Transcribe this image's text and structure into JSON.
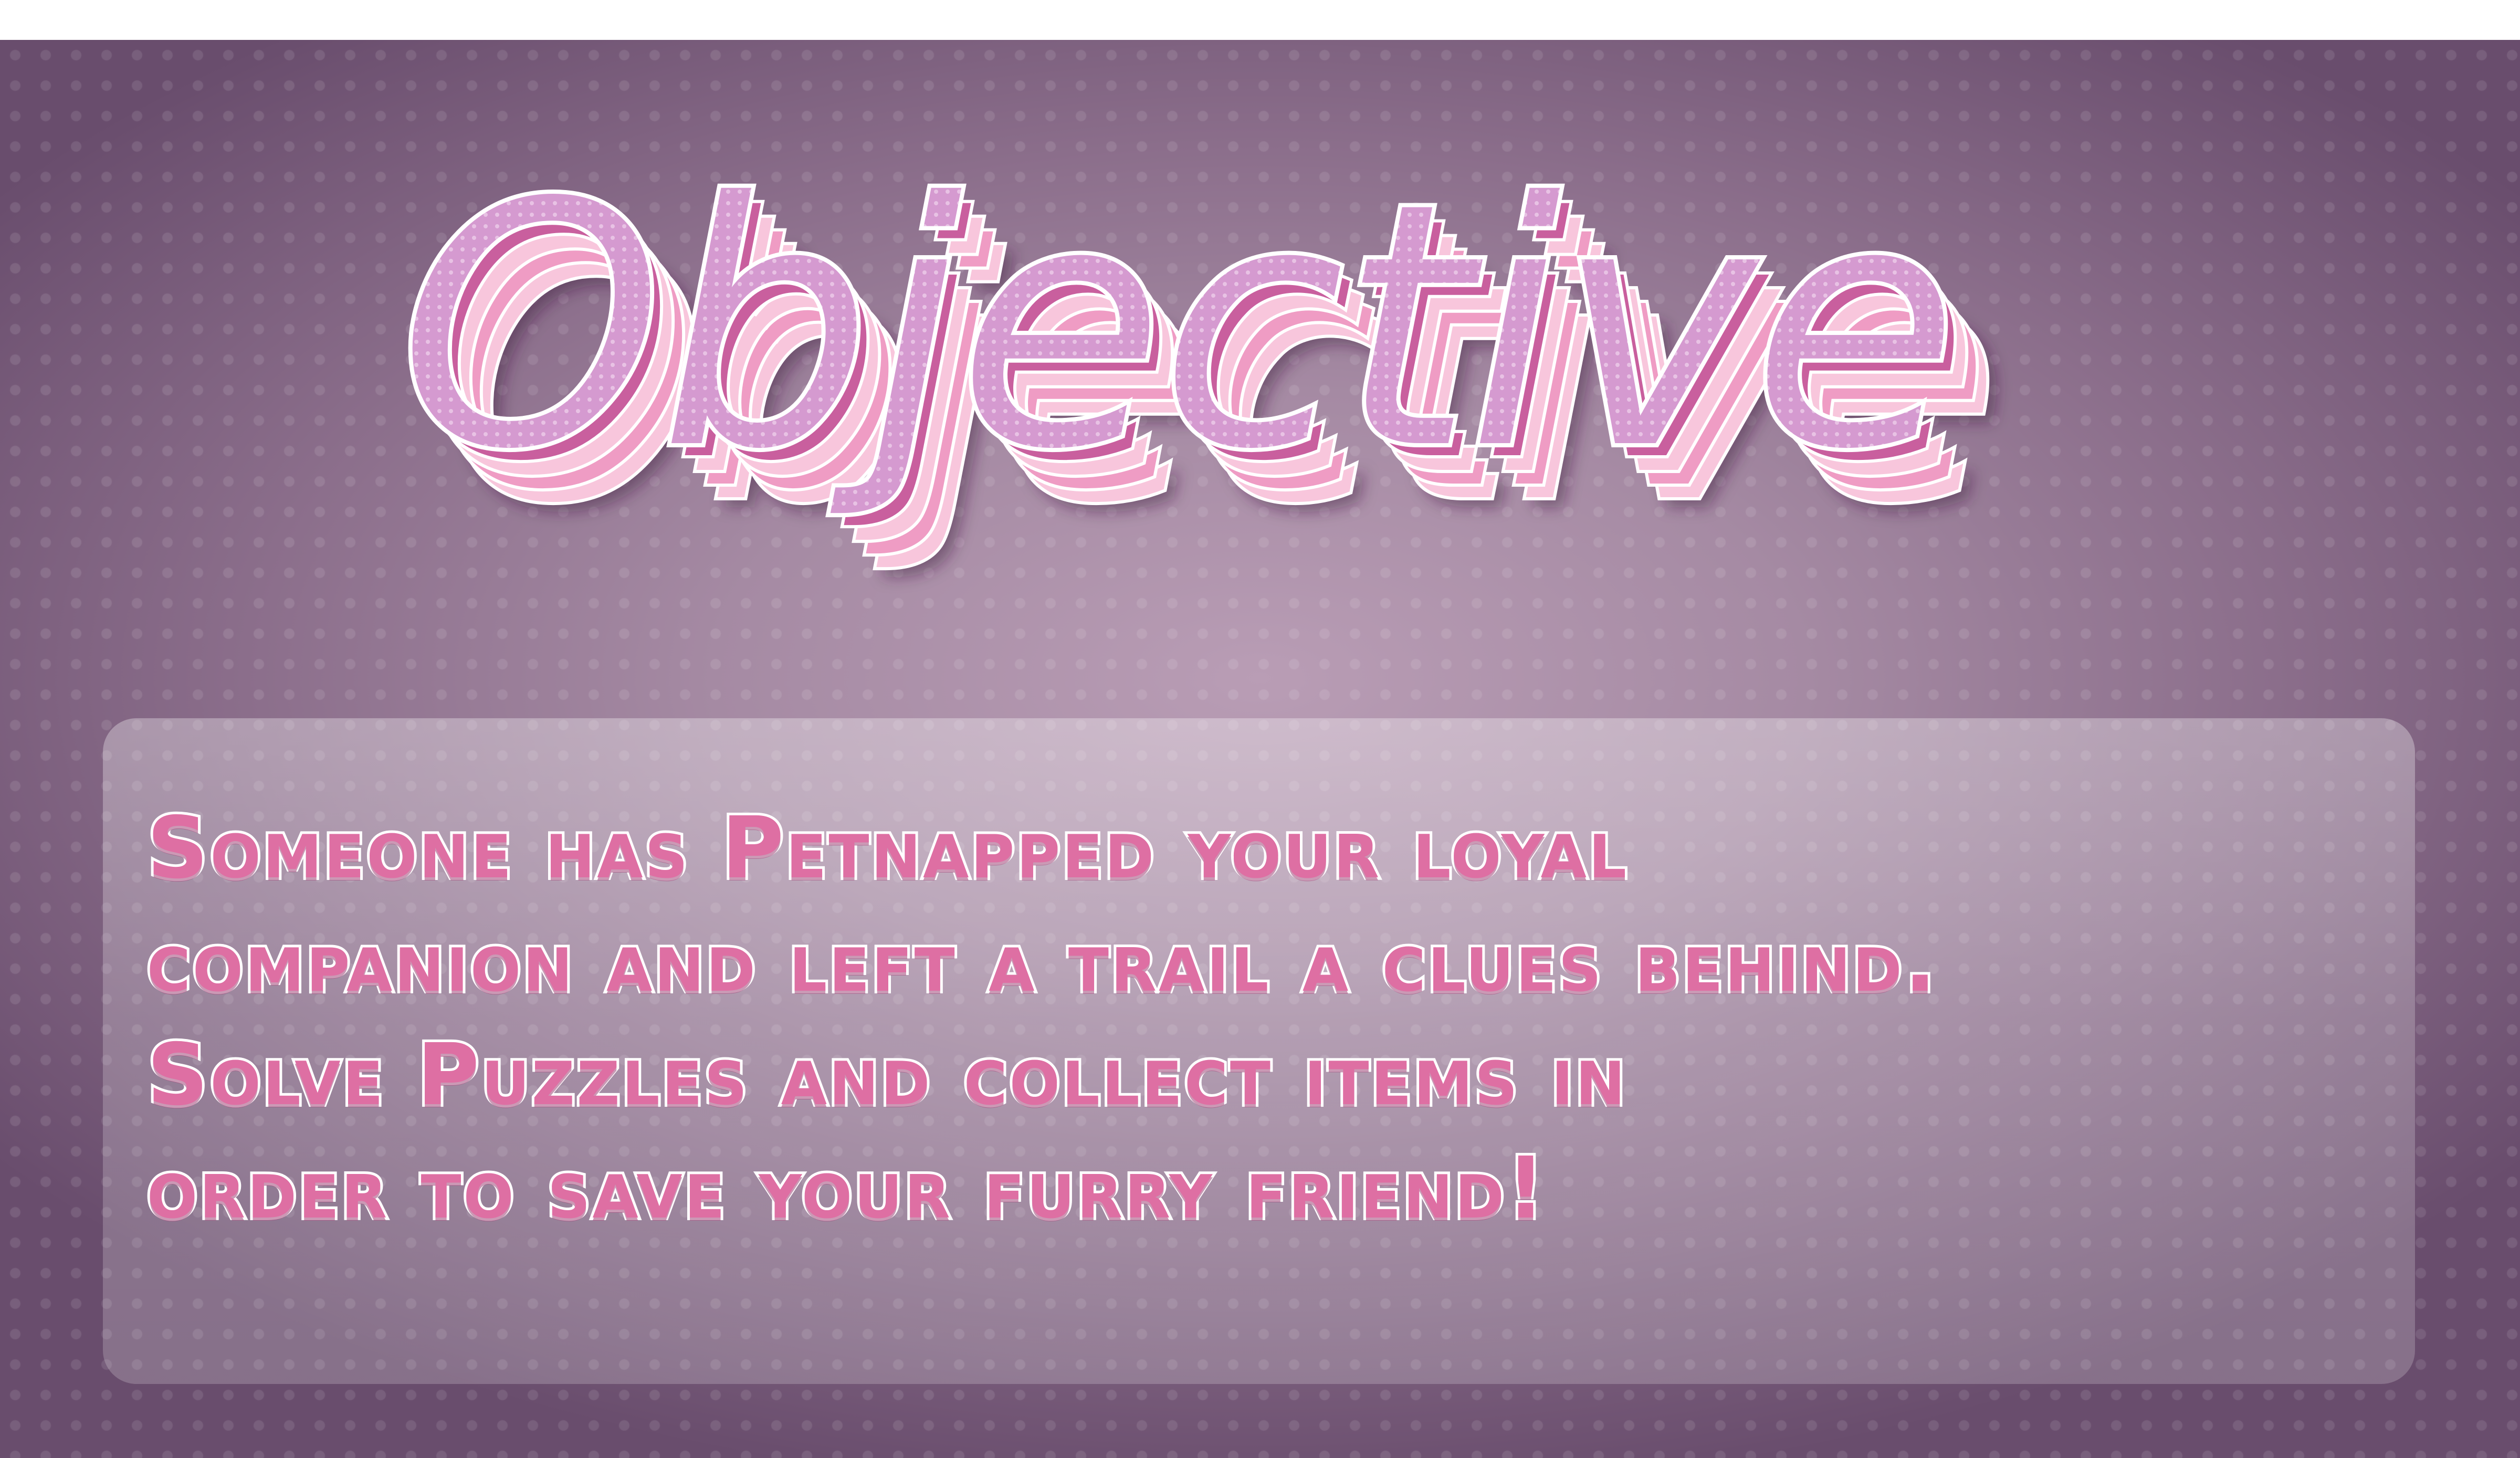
{
  "title": "Objective",
  "description_lines": [
    "Someone has Petnapped your loyal",
    "companion and left a trail a clues behind.",
    "Solve Puzzles and collect items in",
    "order to save your furry friend!"
  ],
  "colors": {
    "title_fill": "#d59ad0",
    "title_outline": "#ffffff",
    "extrusion_dark": "#c95f9e",
    "extrusion_mid": "#ef9cc4",
    "extrusion_light": "#f8c6dc",
    "body_text": "#de6fa3",
    "background": "#8b6e8b"
  }
}
